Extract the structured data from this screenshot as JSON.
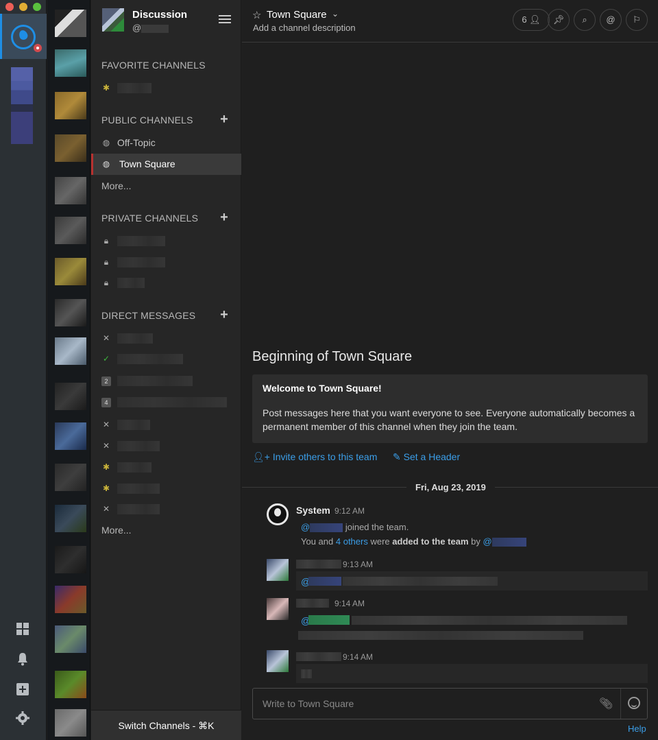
{
  "team": {
    "name": "Discussion",
    "username_prefix": "@"
  },
  "sections": {
    "favorites": "FAVORITE CHANNELS",
    "public": "PUBLIC CHANNELS",
    "private": "PRIVATE CHANNELS",
    "direct": "DIRECT MESSAGES"
  },
  "public_channels": [
    "Off-Topic",
    "Town Square"
  ],
  "more_label": "More...",
  "dm_badges": [
    "2",
    "4"
  ],
  "switch_channels": "Switch Channels - ⌘K",
  "channel": {
    "name": "Town Square",
    "description": "Add a channel description",
    "member_count": "6"
  },
  "intro": {
    "title": "Beginning of Town Square",
    "welcome": "Welcome to Town Square!",
    "text": "Post messages here that you want everyone to see. Everyone automatically becomes a permanent member of this channel when they join the team.",
    "invite": "Invite others to this team",
    "set_header": "Set a Header"
  },
  "date_separator": "Fri, Aug 23, 2019",
  "posts": {
    "system": {
      "name": "System",
      "time": "9:12 AM",
      "joined": "joined the team.",
      "added_prefix": "You and",
      "others": "4 others",
      "added_mid": "were",
      "added_bold": "added to the team",
      "added_by": "by"
    },
    "times": [
      "9:13 AM",
      "9:14 AM",
      "9:14 AM"
    ],
    "mention_prefix": "@"
  },
  "composer": {
    "placeholder": "Write to Town Square"
  },
  "help": "Help",
  "colors": {
    "accent": "#3b9ee8",
    "active_marker": "#b8312f",
    "brand": "#1e8ee5"
  }
}
